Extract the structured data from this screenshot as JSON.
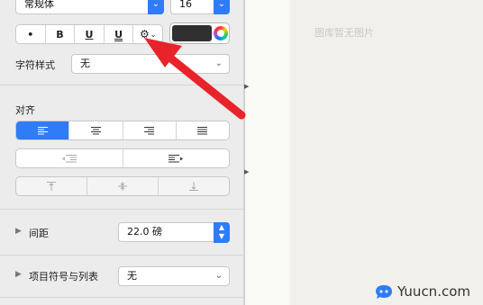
{
  "font": {
    "family_value": "常规体",
    "size_value": "16"
  },
  "style_buttons": [
    "•",
    "B",
    "U",
    "U",
    "⚙"
  ],
  "text_color": "#303030",
  "char_style": {
    "label": "字符样式",
    "value": "无"
  },
  "alignment": {
    "label": "对齐",
    "horizontal": [
      "align-left",
      "align-center",
      "align-right",
      "justify"
    ],
    "vertical": [
      "top",
      "middle",
      "bottom"
    ]
  },
  "spacing": {
    "label": "间距",
    "value": "22.0 磅"
  },
  "bullets": {
    "label": "项目符号与列表",
    "value": "无"
  },
  "canvas": {
    "placeholder": "图库暂无图片"
  },
  "watermark": {
    "text": "Yuucn.com"
  },
  "colors": {
    "accent": "#2f7cf6",
    "arrow": "#e8232a"
  }
}
